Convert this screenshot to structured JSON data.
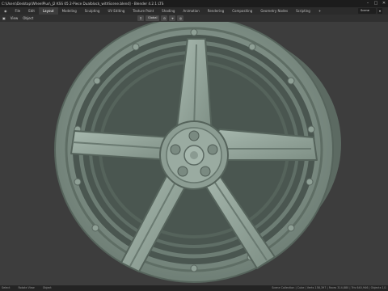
{
  "window": {
    "title": "C:\\Users\\Desktop\\WheelPlus\\_J2 KSS 05 2-Piece Dualblock_withScene.blend] - Blender 4.2.1 LTS",
    "controls": [
      "–",
      "□",
      "✕"
    ]
  },
  "workspaces": {
    "tabs": [
      "Layout",
      "Modeling",
      "Sculpting",
      "UV Editing",
      "Texture Paint",
      "Shading",
      "Animation",
      "Rendering",
      "Compositing",
      "Geometry Nodes",
      "Scripting",
      "+"
    ],
    "scene_name": "Scene"
  },
  "header": {
    "menus": [
      "View",
      "Object"
    ],
    "orientation": "Global",
    "icons": [
      "transform-pivot-icon",
      "snap-icon",
      "proportional-edit-icon"
    ]
  },
  "status": {
    "left": [
      "Select",
      "Rotate View",
      "Object"
    ],
    "right": "Scene Collection | Cube | Verts 158,397 | Faces 314,880 | Tris 640,946 | Objects 1/1"
  }
}
